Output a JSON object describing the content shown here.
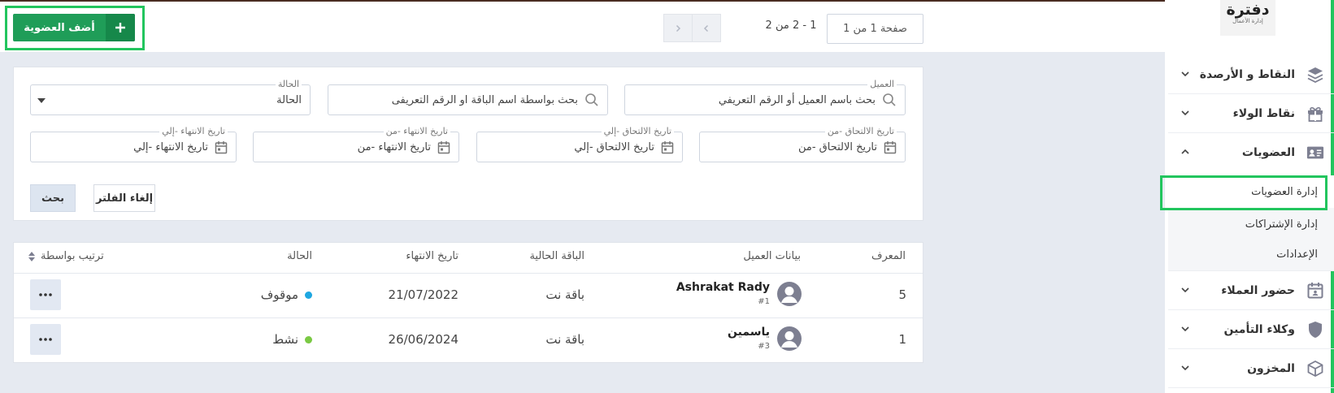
{
  "header": {
    "add_button_label": "أضف العضوية",
    "page_info": "صفحة 1 من 1",
    "range_info": "1 - 2 من 2"
  },
  "sidebar": {
    "logo_text": "دفترة",
    "logo_sub": "إدارة الأعمال",
    "items": [
      {
        "label": "النقاط و الأرصدة",
        "icon": "layers-icon"
      },
      {
        "label": "نقاط الولاء",
        "icon": "gift-icon"
      },
      {
        "label": "العضويات",
        "icon": "id-card-icon"
      },
      {
        "label": "حضور العملاء",
        "icon": "calendar-icon"
      },
      {
        "label": "وكلاء التأمين",
        "icon": "shield-icon"
      },
      {
        "label": "المخزون",
        "icon": "box-icon"
      }
    ],
    "sub_items": [
      {
        "label": "إدارة العضويات",
        "active": true
      },
      {
        "label": "إدارة الإشتراكات",
        "active": false
      },
      {
        "label": "الإعدادات",
        "active": false
      }
    ]
  },
  "filters": {
    "client": {
      "legend": "العميل",
      "placeholder": "بحث باسم العميل أو الرقم التعريفي"
    },
    "package": {
      "placeholder": "بحث بواسطة اسم الباقة او الرقم التعريفى"
    },
    "status": {
      "legend": "الحالة",
      "value": "الحالة"
    },
    "join_from": {
      "legend": "تاريخ الالتحاق -من",
      "placeholder": "تاريخ الالتحاق -من"
    },
    "join_to": {
      "legend": "تاريخ الالتحاق -إلي",
      "placeholder": "تاريخ الالتحاق -إلي"
    },
    "end_from": {
      "legend": "تاريخ الانتهاء -من",
      "placeholder": "تاريخ الانتهاء -من"
    },
    "end_to": {
      "legend": "تاريخ الانتهاء -إلي",
      "placeholder": "تاريخ الانتهاء -إلي"
    },
    "clear_label": "إلغاء الفلتر",
    "search_label": "بحث"
  },
  "table": {
    "headers": {
      "id": "المعرف",
      "client": "بيانات العميل",
      "package": "الباقة الحالية",
      "end_date": "تاريخ الانتهاء",
      "status": "الحالة",
      "sort": "ترتيب بواسطة"
    },
    "rows": [
      {
        "id": "5",
        "name": "Ashrakat Rady",
        "code": "#1",
        "package": "باقة نت",
        "end_date": "21/07/2022",
        "status": "موقوف",
        "status_color": "#1ea7e1"
      },
      {
        "id": "1",
        "name": "ياسمين",
        "code": "#3",
        "package": "باقة نت",
        "end_date": "26/06/2024",
        "status": "نشط",
        "status_color": "#7ac943"
      }
    ]
  },
  "colors": {
    "primary_green": "#1f9d58",
    "highlight": "#22c55e",
    "nav_icon": "#7d7f91"
  }
}
